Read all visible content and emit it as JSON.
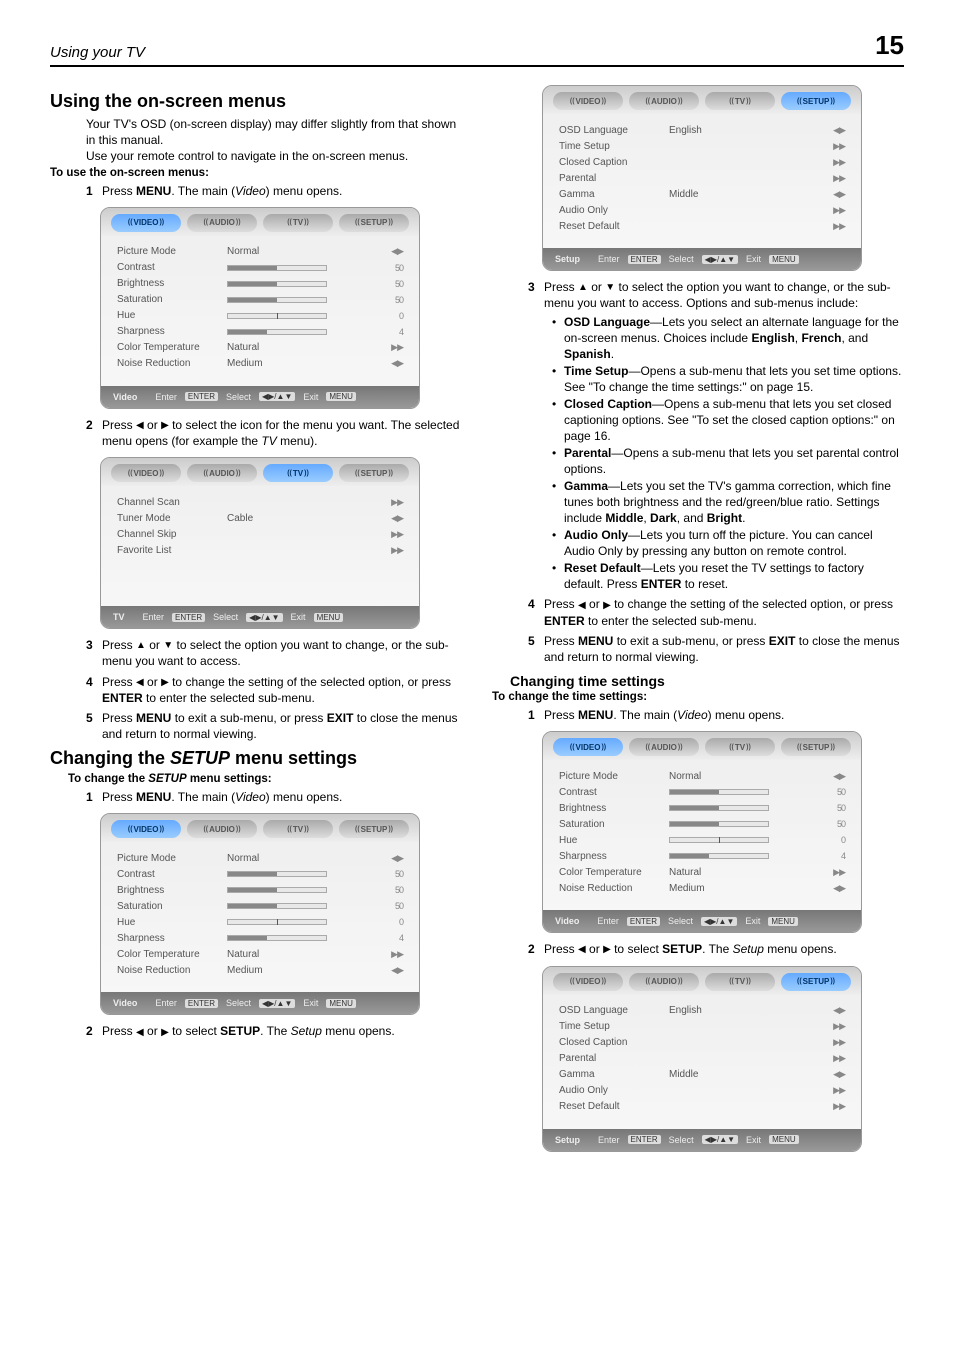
{
  "header": {
    "title": "Using your TV",
    "page": "15"
  },
  "left": {
    "h2a": "Using the on-screen menus",
    "intro1": "Your TV's OSD (on-screen display) may differ slightly from that shown in this manual.",
    "intro2": "Use your remote control to navigate in the on-screen menus.",
    "toUse": "To use the on-screen menus:",
    "step1": {
      "n": "1",
      "pre": "Press ",
      "menu": "MENU",
      "post": ". The main (",
      "video": "Video",
      "post2": ") menu opens."
    },
    "step2": {
      "n": "2",
      "pre": "Press ",
      "mid": " or ",
      "post": " to select the icon for the menu you want. The selected menu opens (for example the ",
      "tv": "TV",
      "post2": " menu)."
    },
    "step3": {
      "n": "3",
      "pre": "Press ",
      "mid": " or ",
      "post": " to select the option you want to change, or the sub-menu you want to access."
    },
    "step4": {
      "n": "4",
      "pre": "Press ",
      "mid": " or ",
      "post": " to change the setting of the selected option, or press ",
      "enter": "ENTER",
      "post2": " to enter the selected sub-menu."
    },
    "step5": {
      "n": "5",
      "pre": "Press ",
      "menu": "MENU",
      "mid": " to exit a sub-menu, or press ",
      "exit": "EXIT",
      "post": " to close the menus and return to normal viewing."
    },
    "h2b": "Changing the ",
    "h2b_setup": "SETUP",
    "h2b_rest": " menu settings",
    "toChangeSetup_pre": "To change the ",
    "toChangeSetup_setup": "SETUP",
    "toChangeSetup_post": " menu settings:",
    "cs_step1": {
      "n": "1",
      "pre": "Press ",
      "menu": "MENU",
      "post": ". The main (",
      "video": "Video",
      "post2": ") menu opens."
    },
    "cs_step2": {
      "n": "2",
      "pre": "Press ",
      "mid": " or ",
      "post": " to select ",
      "setup": "SETUP",
      "post2": ". The ",
      "setupI": "Setup",
      "post3": " menu opens."
    }
  },
  "right": {
    "step3": {
      "n": "3",
      "pre": "Press ",
      "mid": " or ",
      "post": " to select the option you want to change, or the sub-menu you want to access. Options and sub-menus include:"
    },
    "bullets": [
      {
        "name": "OSD Language",
        "text": "—Lets you select an alternate language for the on-screen menus. Choices include ",
        "b1": "English",
        "sep1": ", ",
        "b2": "French",
        "sep2": ", and ",
        "b3": "Spanish",
        "end": "."
      },
      {
        "name": "Time Setup",
        "text": "—Opens a sub-menu that lets you set time options. See \"To change the time settings:\" on page 15."
      },
      {
        "name": "Closed Caption",
        "text": "—Opens a sub-menu that lets you set closed captioning options. See \"To set the closed caption options:\" on page 16."
      },
      {
        "name": "Parental",
        "text": "—Opens a sub-menu that lets you set parental control options."
      },
      {
        "name": "Gamma",
        "text": "—Lets you set the TV's gamma correction, which fine tunes both brightness and the red/green/blue ratio. Settings include ",
        "b1": "Middle",
        "sep1": ", ",
        "b2": "Dark",
        "sep2": ", and ",
        "b3": "Bright",
        "end": "."
      },
      {
        "name": "Audio Only",
        "text": "—Lets you turn off the picture. You can cancel Audio Only by pressing any button on remote control."
      },
      {
        "name": "Reset Default",
        "text": "—Lets you reset the TV settings to factory default. Press ",
        "b1": "ENTER",
        "end": " to reset."
      }
    ],
    "step4": {
      "n": "4",
      "pre": "Press ",
      "mid": " or ",
      "post": " to change the setting of the selected option, or press ",
      "enter": "ENTER",
      "post2": " to enter the selected sub-menu."
    },
    "step5": {
      "n": "5",
      "pre": "Press ",
      "menu": "MENU",
      "mid": " to exit a sub-menu, or press ",
      "exit": "EXIT",
      "post": " to close the menus and return to normal viewing."
    },
    "h3": "Changing time settings",
    "toChangeTime": "To change the time settings:",
    "ct_step1": {
      "n": "1",
      "pre": "Press ",
      "menu": "MENU",
      "post": ". The main (",
      "video": "Video",
      "post2": ") menu opens."
    },
    "ct_step2": {
      "n": "2",
      "pre": "Press ",
      "mid": " or ",
      "post": " to select ",
      "setup": "SETUP",
      "post2": ". The ",
      "setupI": "Setup",
      "post3": " menu opens."
    }
  },
  "osd": {
    "tabs": {
      "video": "VIDEO",
      "audio": "AUDIO",
      "tv": "TV",
      "setup": "SETUP"
    },
    "video": {
      "rows": [
        {
          "label": "Picture Mode",
          "value": "Normal",
          "ind": "◀▶"
        },
        {
          "label": "Contrast",
          "bar": 50,
          "num": "50"
        },
        {
          "label": "Brightness",
          "bar": 50,
          "num": "50"
        },
        {
          "label": "Saturation",
          "bar": 50,
          "num": "50"
        },
        {
          "label": "Hue",
          "tick": 50,
          "num": "0"
        },
        {
          "label": "Sharpness",
          "bar": 40,
          "num": "4"
        },
        {
          "label": "Color Temperature",
          "value": "Natural",
          "ind": "▶▶"
        },
        {
          "label": "Noise Reduction",
          "value": "Medium",
          "ind": "◀▶"
        }
      ],
      "footerName": "Video"
    },
    "tv": {
      "rows": [
        {
          "label": "Channel Scan",
          "value": "",
          "ind": "▶▶"
        },
        {
          "label": "Tuner Mode",
          "value": "Cable",
          "ind": "◀▶"
        },
        {
          "label": "Channel Skip",
          "value": "",
          "ind": "▶▶"
        },
        {
          "label": "Favorite List",
          "value": "",
          "ind": "▶▶"
        }
      ],
      "footerName": "TV"
    },
    "setup": {
      "rows": [
        {
          "label": "OSD Language",
          "value": "English",
          "ind": "◀▶"
        },
        {
          "label": "Time Setup",
          "value": "",
          "ind": "▶▶"
        },
        {
          "label": "Closed Caption",
          "value": "",
          "ind": "▶▶"
        },
        {
          "label": "Parental",
          "value": "",
          "ind": "▶▶"
        },
        {
          "label": "Gamma",
          "value": "Middle",
          "ind": "◀▶"
        },
        {
          "label": "Audio Only",
          "value": "",
          "ind": "▶▶"
        },
        {
          "label": "Reset Default",
          "value": "",
          "ind": "▶▶"
        }
      ],
      "footerName": "Setup"
    },
    "footer": {
      "enter": "Enter",
      "enterKey": "ENTER",
      "select": "Select",
      "selectKey": "◀▶/▲▼",
      "exit": "Exit",
      "exitKey": "MENU"
    }
  }
}
